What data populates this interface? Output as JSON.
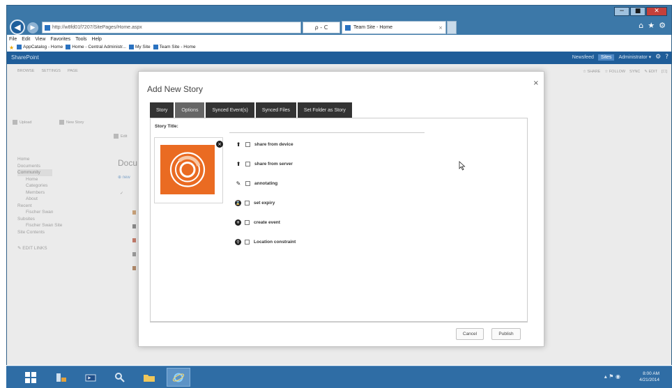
{
  "browser": {
    "address_url": "http://w8fd01f7207/SitePages/Home.aspx",
    "address_tools": "ρ - C",
    "tab_title": "Team Site - Home",
    "tab_close": "×",
    "back_glyph": "◀",
    "forward_glyph": "▶",
    "caption_minimize": "−",
    "caption_maximize": "■",
    "caption_close": "✕",
    "caption_icons": [
      "⌂",
      "★",
      "⚙"
    ],
    "menu": [
      "File",
      "Edit",
      "View",
      "Favorites",
      "Tools",
      "Help"
    ],
    "favorites": [
      "AppCatalog - Home",
      "Home - Central Administr...",
      "My Site",
      "Team Site - Home"
    ]
  },
  "sharepoint": {
    "brand": "SharePoint",
    "suite_sites": "Sites",
    "suite_user": "Administrator ▾",
    "suite_newsfeed": "Newsfeed",
    "ribbon_tabs": [
      "BROWSE",
      "SETTINGS",
      "PAGE"
    ],
    "ribbon_right": [
      "☆ SHARE",
      "☆ FOLLOW",
      "SYNC",
      "✎ EDIT",
      "[☐]"
    ],
    "cmd_upload": "Upload",
    "cmd_new_story": "New Story",
    "cmd_edit": "Edit",
    "nav": [
      "Home",
      "Documents",
      "Community",
      "Home",
      "Categories",
      "Members",
      "About",
      "Recent",
      "Fischer Swan",
      "Subsites",
      "Fischer Swan Site",
      "Site Contents"
    ],
    "nav_edit": "✎ EDIT LINKS",
    "docs_heading": "Docu",
    "docs_new": "⊕ new",
    "docs_check": "✓"
  },
  "modal": {
    "title": "Add New Story",
    "close": "×",
    "tabs": [
      {
        "label": "Story",
        "active": false
      },
      {
        "label": "Options",
        "active": true
      },
      {
        "label": "Synced Event(s)",
        "active": false
      },
      {
        "label": "Synced Files",
        "active": false
      },
      {
        "label": "Set Folder as Story",
        "active": false
      }
    ],
    "story_title_label": "Story Title:",
    "image_remove": "×",
    "options": [
      {
        "icon": "⬆",
        "label": "share from device"
      },
      {
        "icon": "⬆",
        "label": "share from server"
      },
      {
        "icon": "✎",
        "label": "annotating"
      },
      {
        "icon": "⌛",
        "label": "set expiry"
      },
      {
        "icon": "+",
        "label": "create event"
      },
      {
        "icon": "⚲",
        "label": "Location constraint"
      }
    ],
    "cancel": "Cancel",
    "publish": "Publish"
  },
  "taskbar": {
    "tray_icons": "▴ ⚑ ◉",
    "time": "8:00 AM",
    "date": "4/21/2014"
  },
  "colors": {
    "sharepoint_blue": "#1f5d99",
    "tab_dark": "#333333",
    "tab_active": "#666666",
    "logo_orange": "#ea6b22",
    "taskbar": "#2f6da5"
  }
}
